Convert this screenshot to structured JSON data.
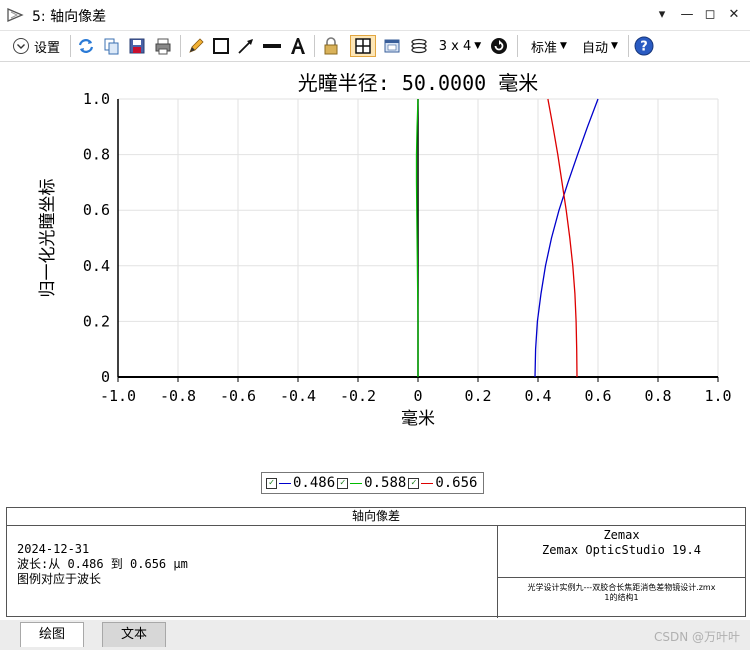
{
  "window": {
    "title": "5: 轴向像差",
    "controls": [
      "▾",
      "—",
      "◻",
      "✕"
    ]
  },
  "toolbar": {
    "settings_label": "设置",
    "layout_label": "3 x 4",
    "standard_label": "标准",
    "auto_label": "自动"
  },
  "chart_data": {
    "type": "line",
    "title": "光瞳半径: 50.0000 毫米",
    "xlabel": "毫米",
    "ylabel": "归一化光瞳坐标",
    "xlim": [
      -1.0,
      1.0
    ],
    "ylim": [
      0,
      1.0
    ],
    "x_ticks": [
      "-1.0",
      "-0.8",
      "-0.6",
      "-0.4",
      "-0.2",
      "0",
      "0.2",
      "0.4",
      "0.6",
      "0.8",
      "1.0"
    ],
    "y_ticks": [
      "0",
      "0.2",
      "0.4",
      "0.6",
      "0.8",
      "1.0"
    ],
    "grid": true,
    "series": [
      {
        "name": "0.486",
        "color": "#0000cc",
        "points": [
          [
            0.39,
            0.0
          ],
          [
            0.392,
            0.1
          ],
          [
            0.398,
            0.2
          ],
          [
            0.41,
            0.3
          ],
          [
            0.425,
            0.4
          ],
          [
            0.445,
            0.5
          ],
          [
            0.47,
            0.6
          ],
          [
            0.5,
            0.7
          ],
          [
            0.532,
            0.8
          ],
          [
            0.565,
            0.9
          ],
          [
            0.6,
            1.0
          ]
        ]
      },
      {
        "name": "0.588",
        "color": "#00bb00",
        "points": [
          [
            0.0,
            0.0
          ],
          [
            0.0,
            0.1
          ],
          [
            0.0,
            0.2
          ],
          [
            -0.001,
            0.3
          ],
          [
            -0.002,
            0.4
          ],
          [
            -0.003,
            0.5
          ],
          [
            -0.004,
            0.6
          ],
          [
            -0.005,
            0.7
          ],
          [
            -0.005,
            0.8
          ],
          [
            -0.003,
            0.9
          ],
          [
            0.0,
            1.0
          ]
        ]
      },
      {
        "name": "0.656",
        "color": "#dd0000",
        "points": [
          [
            0.53,
            0.0
          ],
          [
            0.529,
            0.1
          ],
          [
            0.527,
            0.2
          ],
          [
            0.523,
            0.3
          ],
          [
            0.516,
            0.4
          ],
          [
            0.506,
            0.5
          ],
          [
            0.494,
            0.6
          ],
          [
            0.48,
            0.7
          ],
          [
            0.466,
            0.8
          ],
          [
            0.45,
            0.9
          ],
          [
            0.433,
            1.0
          ]
        ]
      }
    ]
  },
  "legend": {
    "entries": [
      {
        "label": "0.486",
        "color": "#0000cc"
      },
      {
        "label": "0.588",
        "color": "#00bb00"
      },
      {
        "label": "0.656",
        "color": "#dd0000"
      }
    ]
  },
  "info": {
    "title": "轴向像差",
    "date": "2024-12-31",
    "wavelength_line": "波长:从 0.486 到 0.656 μm",
    "legend_note": "图例对应于波长",
    "brand1": "Zemax",
    "brand2": "Zemax OpticStudio 19.4",
    "file1": "光学设计实例九---双胶合长焦距消色差物镜设计.zmx",
    "file2": "1的结构1"
  },
  "tabs": [
    "绘图",
    "文本"
  ],
  "watermark": "CSDN @万叶叶"
}
